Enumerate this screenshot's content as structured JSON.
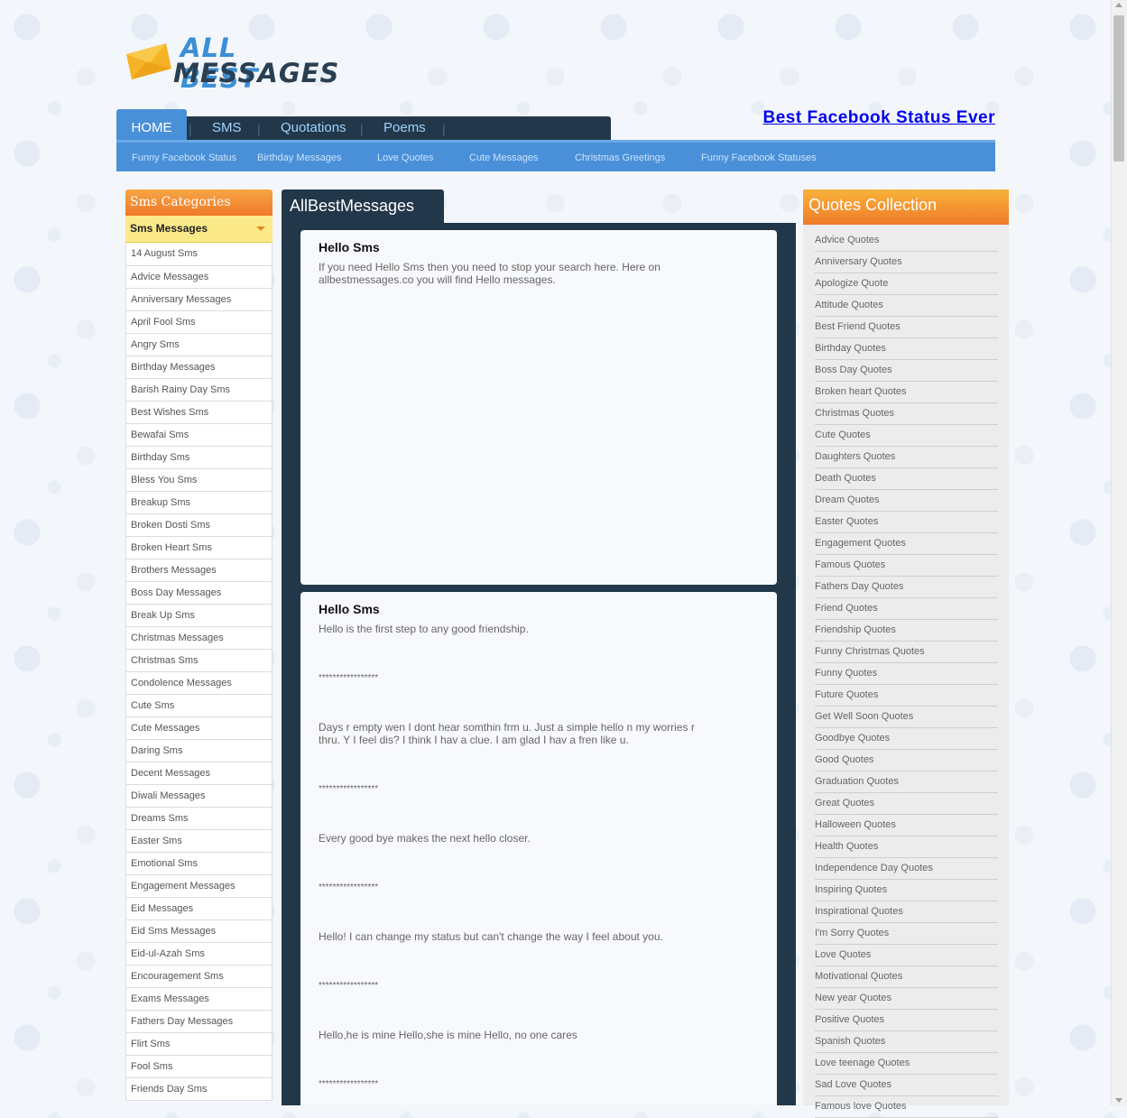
{
  "header": {
    "logo_line1": "ALL BEST",
    "logo_line2": "MESSAGES",
    "facebook_link": "Best Facebook Status Ever"
  },
  "nav": {
    "items": [
      "HOME",
      "SMS",
      "Quotations",
      "Poems"
    ],
    "active": "HOME",
    "sub_items": [
      "Funny Facebook Status",
      "Birthday Messages",
      "Love Quotes",
      "Cute Messages",
      "Christmas Greetings",
      "Funny Facebook Statuses"
    ]
  },
  "left_sidebar": {
    "title": "Sms Categories",
    "selected": "Sms Messages",
    "items": [
      "14 August Sms",
      "Advice Messages",
      "Anniversary Messages",
      "April Fool Sms",
      "Angry Sms",
      "Birthday Messages",
      "Barish Rainy Day Sms",
      "Best Wishes Sms",
      "Bewafai Sms",
      "Birthday Sms",
      "Bless You Sms",
      "Breakup Sms",
      "Broken Dosti Sms",
      "Broken Heart Sms",
      "Brothers Messages",
      "Boss Day Messages",
      "Break Up Sms",
      "Christmas Messages",
      "Christmas Sms",
      "Condolence Messages",
      "Cute Sms",
      "Cute Messages",
      "Daring Sms",
      "Decent Messages",
      "Diwali Messages",
      "Dreams Sms",
      "Easter Sms",
      "Emotional Sms",
      "Engagement Messages",
      "Eid Messages",
      "Eid Sms Messages",
      "Eid-ul-Azah Sms",
      "Encouragement Sms",
      "Exams Messages",
      "Fathers Day Messages",
      "Flirt Sms",
      "Fool Sms",
      "Friends Day Sms"
    ]
  },
  "main": {
    "tab_title": "AllBestMessages",
    "card1": {
      "title": "Hello Sms",
      "text": "If you need Hello Sms then you need to stop your search here. Here on allbestmessages.co you will find Hello messages."
    },
    "card2": {
      "title": "Hello Sms",
      "blocks": [
        {
          "type": "para",
          "text": "Hello is the first step to any good friendship."
        },
        {
          "type": "stars",
          "text": "*****************"
        },
        {
          "type": "para",
          "text": "Days r empty wen I dont hear somthin frm u. Just a simple hello n my worries r thru. Y I feel dis? I think I hav a clue. I am glad I hav a fren like u."
        },
        {
          "type": "stars",
          "text": "*****************"
        },
        {
          "type": "para",
          "text": "Every good bye makes the next hello closer."
        },
        {
          "type": "stars",
          "text": "*****************"
        },
        {
          "type": "para",
          "text": "Hello! I can change my status but can't change the way I feel about you."
        },
        {
          "type": "stars",
          "text": "*****************"
        },
        {
          "type": "para",
          "text": "Hello,he is mine Hello,she is mine Hello, no one cares"
        },
        {
          "type": "stars",
          "text": "*****************"
        }
      ]
    }
  },
  "right_sidebar": {
    "title": "Quotes Collection",
    "items": [
      "Advice Quotes",
      "Anniversary Quotes",
      "Apologize Quote",
      "Attitude Quotes",
      "Best Friend Quotes",
      "Birthday Quotes",
      "Boss Day Quotes",
      "Broken heart Quotes",
      "Christmas Quotes",
      "Cute Quotes",
      "Daughters Quotes",
      "Death Quotes",
      "Dream Quotes",
      "Easter Quotes",
      "Engagement Quotes",
      "Famous Quotes",
      "Fathers Day Quotes",
      "Friend Quotes",
      "Friendship Quotes",
      "Funny Christmas Quotes",
      "Funny Quotes",
      "Future Quotes",
      "Get Well Soon Quotes",
      "Goodbye Quotes",
      "Good Quotes",
      "Graduation Quotes",
      "Great Quotes",
      "Halloween Quotes",
      "Health Quotes",
      "Independence Day Quotes",
      "Inspiring Quotes",
      "Inspirational Quotes",
      "I'm Sorry Quotes",
      "Love Quotes",
      "Motivational Quotes",
      "New year Quotes",
      "Positive Quotes",
      "Spanish Quotes",
      "Love teenage Quotes",
      "Sad Love Quotes",
      "Famous love Quotes"
    ]
  },
  "colors": {
    "nav_dark": "#223749",
    "nav_blue": "#4a90d9",
    "orange": "#ef7a2a",
    "highlight_yellow": "#fbe98a"
  }
}
